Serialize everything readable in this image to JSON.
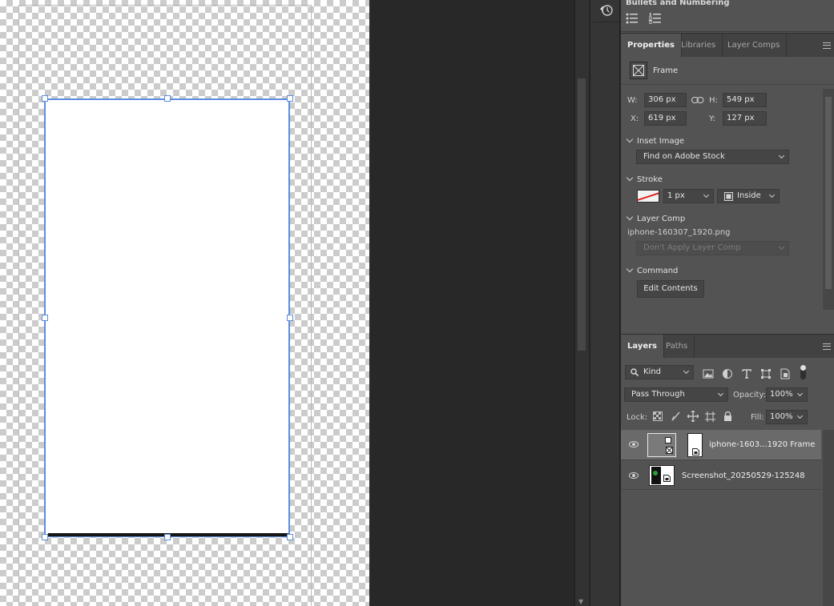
{
  "canvas": {},
  "bullets_panel": {
    "title": "Bullets and Numbering"
  },
  "properties_tabs": [
    "Properties",
    "Libraries",
    "Layer Comps"
  ],
  "properties": {
    "type_label": "Frame",
    "w_label": "W:",
    "w_value": "306 px",
    "h_label": "H:",
    "h_value": "549 px",
    "x_label": "X:",
    "x_value": "619 px",
    "y_label": "Y:",
    "y_value": "127 px",
    "inset_image": {
      "heading": "Inset Image",
      "dropdown": "Find on Adobe Stock"
    },
    "stroke": {
      "heading": "Stroke",
      "size": "1 px",
      "alignment": "Inside"
    },
    "layer_comp": {
      "heading": "Layer Comp",
      "file": "iphone-160307_1920.png",
      "dropdown": "Don't Apply Layer Comp"
    },
    "command": {
      "heading": "Command",
      "button": "Edit Contents"
    }
  },
  "layers_tabs": [
    "Layers",
    "Paths"
  ],
  "layers": {
    "filter_kind": "Kind",
    "blend_mode": "Pass Through",
    "opacity_label": "Opacity:",
    "opacity_value": "100%",
    "lock_label": "Lock:",
    "fill_label": "Fill:",
    "fill_value": "100%",
    "items": [
      {
        "name": "iphone-1603...1920 Frame",
        "selected": true
      },
      {
        "name": "Screenshot_20250529-125248",
        "selected": false
      }
    ]
  },
  "colors": {
    "selection": "#5d8edb",
    "panel_bg": "#535353",
    "pasteboard": "#282828"
  }
}
